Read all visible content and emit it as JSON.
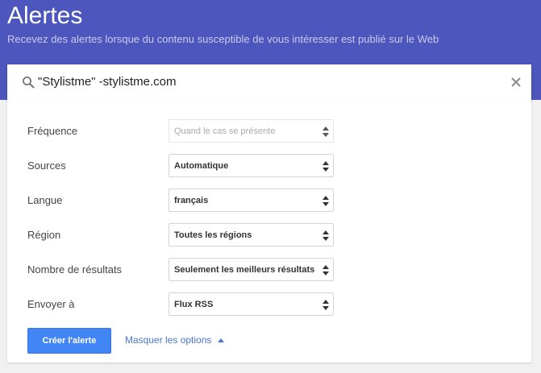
{
  "header": {
    "title": "Alertes",
    "subtitle": "Recevez des alertes lorsque du contenu susceptible de vous intéresser est publié sur le Web"
  },
  "search": {
    "value": "\"Stylistme\" -stylistme.com",
    "icon": "search-icon",
    "clear_icon": "close-icon"
  },
  "options": [
    {
      "label": "Fréquence",
      "value": "Quand le cas se présente",
      "disabled": true
    },
    {
      "label": "Sources",
      "value": "Automatique",
      "disabled": false
    },
    {
      "label": "Langue",
      "value": "français",
      "disabled": false
    },
    {
      "label": "Région",
      "value": "Toutes les régions",
      "disabled": false
    },
    {
      "label": "Nombre de résultats",
      "value": "Seulement les meilleurs résultats",
      "disabled": false
    },
    {
      "label": "Envoyer à",
      "value": "Flux RSS",
      "disabled": false
    }
  ],
  "actions": {
    "create_label": "Créer l'alerte",
    "hide_options_label": "Masquer les options"
  },
  "colors": {
    "header_bg": "#4d56bd",
    "primary_button": "#4285f4",
    "link": "#4a77c8"
  }
}
